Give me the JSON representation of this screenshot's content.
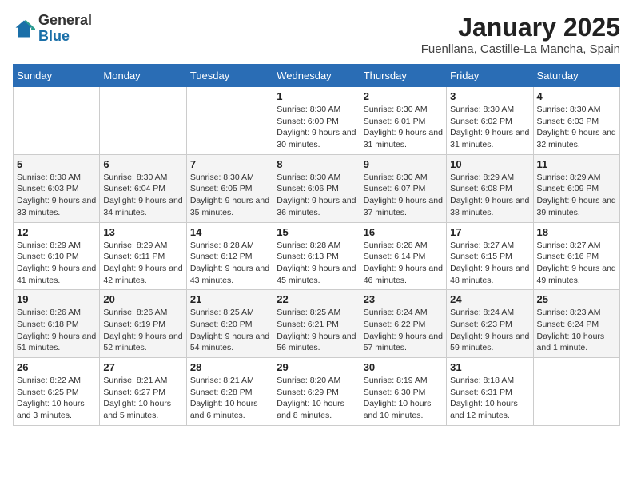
{
  "header": {
    "logo_line1": "General",
    "logo_line2": "Blue",
    "month_title": "January 2025",
    "location": "Fuenllana, Castille-La Mancha, Spain"
  },
  "weekdays": [
    "Sunday",
    "Monday",
    "Tuesday",
    "Wednesday",
    "Thursday",
    "Friday",
    "Saturday"
  ],
  "weeks": [
    [
      {
        "day": "",
        "info": ""
      },
      {
        "day": "",
        "info": ""
      },
      {
        "day": "",
        "info": ""
      },
      {
        "day": "1",
        "info": "Sunrise: 8:30 AM\nSunset: 6:00 PM\nDaylight: 9 hours and 30 minutes."
      },
      {
        "day": "2",
        "info": "Sunrise: 8:30 AM\nSunset: 6:01 PM\nDaylight: 9 hours and 31 minutes."
      },
      {
        "day": "3",
        "info": "Sunrise: 8:30 AM\nSunset: 6:02 PM\nDaylight: 9 hours and 31 minutes."
      },
      {
        "day": "4",
        "info": "Sunrise: 8:30 AM\nSunset: 6:03 PM\nDaylight: 9 hours and 32 minutes."
      }
    ],
    [
      {
        "day": "5",
        "info": "Sunrise: 8:30 AM\nSunset: 6:03 PM\nDaylight: 9 hours and 33 minutes."
      },
      {
        "day": "6",
        "info": "Sunrise: 8:30 AM\nSunset: 6:04 PM\nDaylight: 9 hours and 34 minutes."
      },
      {
        "day": "7",
        "info": "Sunrise: 8:30 AM\nSunset: 6:05 PM\nDaylight: 9 hours and 35 minutes."
      },
      {
        "day": "8",
        "info": "Sunrise: 8:30 AM\nSunset: 6:06 PM\nDaylight: 9 hours and 36 minutes."
      },
      {
        "day": "9",
        "info": "Sunrise: 8:30 AM\nSunset: 6:07 PM\nDaylight: 9 hours and 37 minutes."
      },
      {
        "day": "10",
        "info": "Sunrise: 8:29 AM\nSunset: 6:08 PM\nDaylight: 9 hours and 38 minutes."
      },
      {
        "day": "11",
        "info": "Sunrise: 8:29 AM\nSunset: 6:09 PM\nDaylight: 9 hours and 39 minutes."
      }
    ],
    [
      {
        "day": "12",
        "info": "Sunrise: 8:29 AM\nSunset: 6:10 PM\nDaylight: 9 hours and 41 minutes."
      },
      {
        "day": "13",
        "info": "Sunrise: 8:29 AM\nSunset: 6:11 PM\nDaylight: 9 hours and 42 minutes."
      },
      {
        "day": "14",
        "info": "Sunrise: 8:28 AM\nSunset: 6:12 PM\nDaylight: 9 hours and 43 minutes."
      },
      {
        "day": "15",
        "info": "Sunrise: 8:28 AM\nSunset: 6:13 PM\nDaylight: 9 hours and 45 minutes."
      },
      {
        "day": "16",
        "info": "Sunrise: 8:28 AM\nSunset: 6:14 PM\nDaylight: 9 hours and 46 minutes."
      },
      {
        "day": "17",
        "info": "Sunrise: 8:27 AM\nSunset: 6:15 PM\nDaylight: 9 hours and 48 minutes."
      },
      {
        "day": "18",
        "info": "Sunrise: 8:27 AM\nSunset: 6:16 PM\nDaylight: 9 hours and 49 minutes."
      }
    ],
    [
      {
        "day": "19",
        "info": "Sunrise: 8:26 AM\nSunset: 6:18 PM\nDaylight: 9 hours and 51 minutes."
      },
      {
        "day": "20",
        "info": "Sunrise: 8:26 AM\nSunset: 6:19 PM\nDaylight: 9 hours and 52 minutes."
      },
      {
        "day": "21",
        "info": "Sunrise: 8:25 AM\nSunset: 6:20 PM\nDaylight: 9 hours and 54 minutes."
      },
      {
        "day": "22",
        "info": "Sunrise: 8:25 AM\nSunset: 6:21 PM\nDaylight: 9 hours and 56 minutes."
      },
      {
        "day": "23",
        "info": "Sunrise: 8:24 AM\nSunset: 6:22 PM\nDaylight: 9 hours and 57 minutes."
      },
      {
        "day": "24",
        "info": "Sunrise: 8:24 AM\nSunset: 6:23 PM\nDaylight: 9 hours and 59 minutes."
      },
      {
        "day": "25",
        "info": "Sunrise: 8:23 AM\nSunset: 6:24 PM\nDaylight: 10 hours and 1 minute."
      }
    ],
    [
      {
        "day": "26",
        "info": "Sunrise: 8:22 AM\nSunset: 6:25 PM\nDaylight: 10 hours and 3 minutes."
      },
      {
        "day": "27",
        "info": "Sunrise: 8:21 AM\nSunset: 6:27 PM\nDaylight: 10 hours and 5 minutes."
      },
      {
        "day": "28",
        "info": "Sunrise: 8:21 AM\nSunset: 6:28 PM\nDaylight: 10 hours and 6 minutes."
      },
      {
        "day": "29",
        "info": "Sunrise: 8:20 AM\nSunset: 6:29 PM\nDaylight: 10 hours and 8 minutes."
      },
      {
        "day": "30",
        "info": "Sunrise: 8:19 AM\nSunset: 6:30 PM\nDaylight: 10 hours and 10 minutes."
      },
      {
        "day": "31",
        "info": "Sunrise: 8:18 AM\nSunset: 6:31 PM\nDaylight: 10 hours and 12 minutes."
      },
      {
        "day": "",
        "info": ""
      }
    ]
  ]
}
